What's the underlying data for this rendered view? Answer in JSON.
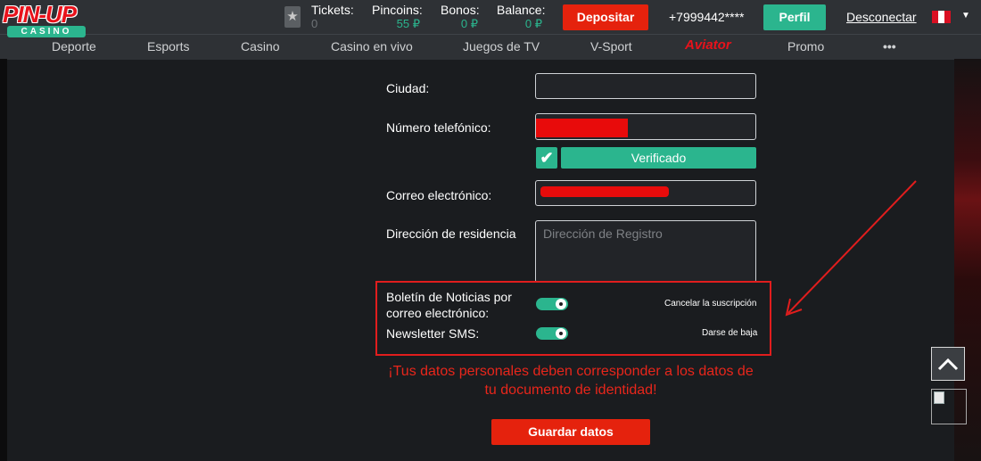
{
  "header": {
    "logo_main": "PIN-UP",
    "logo_sub": "CASINO",
    "favorites_icon": "star-icon",
    "stats": [
      {
        "label": "Tickets:",
        "value": "0"
      },
      {
        "label": "Pincoins:",
        "value": "55 ₽"
      },
      {
        "label": "Bonos:",
        "value": "0 ₽"
      },
      {
        "label": "Balance:",
        "value": "0 ₽"
      }
    ],
    "deposit_label": "Depositar",
    "phone": "+7999442****",
    "profile_label": "Perfil",
    "logout_label": "Desconectar",
    "language_flag": "peru-flag-icon",
    "colors": {
      "accent_red": "#e5220d",
      "accent_green": "#2bb58e",
      "value_green": "#2bb58e"
    }
  },
  "nav": {
    "items": [
      "Deporte",
      "Esports",
      "Casino",
      "Casino en vivo",
      "Juegos de TV",
      "V-Sport",
      "Aviator",
      "Promo",
      "•••"
    ]
  },
  "form": {
    "city_label": "Ciudad:",
    "city_value": "",
    "phone_label": "Número telefónico:",
    "verified_label": "Verificado",
    "email_label": "Correo electrónico:",
    "address_label": "Dirección de residencia",
    "address_placeholder": "Dirección de Registro",
    "newsletter_email_label": "Boletín de Noticias por correo electrónico:",
    "newsletter_email_action": "Cancelar la suscripción",
    "newsletter_email_on": true,
    "newsletter_sms_label": "Newsletter SMS:",
    "newsletter_sms_action": "Darse de baja",
    "newsletter_sms_on": true,
    "warning_text": "¡Tus datos personales deben corresponder a los datos de tu documento de identidad!",
    "save_label": "Guardar datos"
  },
  "widgets": {
    "scroll_up_icon": "chevron-up-icon",
    "broken_image_icon": "broken-image-icon"
  }
}
